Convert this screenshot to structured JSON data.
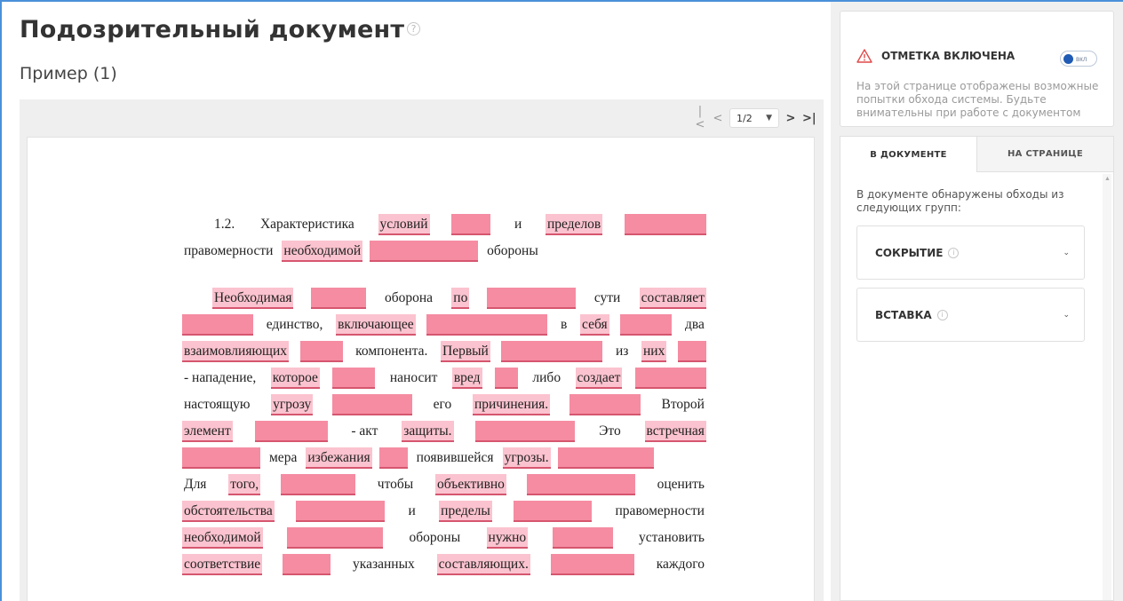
{
  "page": {
    "title": "Подозрительный документ",
    "help_icon": "question-circle-icon",
    "subtitle": "Пример (1)"
  },
  "pager": {
    "first_icon": "|<",
    "prev_icon": "<",
    "current": "1/2",
    "next_icon": ">",
    "last_icon": ">|"
  },
  "document": {
    "lines": [
      {
        "style": "title-indent",
        "tokens": [
          {
            "t": "1.2."
          },
          {
            "t": "Характеристика"
          },
          {
            "t": "условий",
            "hl": true
          },
          {
            "blk": 44
          },
          {
            "t": "и"
          },
          {
            "t": "пределов",
            "hl": true
          },
          {
            "blk": 92
          }
        ]
      },
      {
        "style": "left",
        "gap_after": true,
        "tokens": [
          {
            "t": "правомерности"
          },
          {
            "t": "необходимой",
            "hl": true
          },
          {
            "blk": 122
          },
          {
            "t": "обороны"
          }
        ]
      },
      {
        "style": "indent",
        "tokens": [
          {
            "t": "Необходимая",
            "hl": true
          },
          {
            "blk": 62
          },
          {
            "t": "оборона"
          },
          {
            "t": "по",
            "hl": true
          },
          {
            "blk": 100
          },
          {
            "t": "сути"
          },
          {
            "t": "составляет",
            "hl": true
          }
        ]
      },
      {
        "style": "justify",
        "tokens": [
          {
            "blk": 80
          },
          {
            "t": "единство,"
          },
          {
            "t": "включающее",
            "hl": true
          },
          {
            "blk": 136
          },
          {
            "t": "в"
          },
          {
            "t": "себя",
            "hl": true
          },
          {
            "blk": 58
          },
          {
            "t": "два"
          }
        ]
      },
      {
        "style": "justify",
        "tokens": [
          {
            "t": "взаимовлияющих",
            "hl": true
          },
          {
            "blk": 48
          },
          {
            "t": "компонента."
          },
          {
            "t": "Первый",
            "hl": true
          },
          {
            "blk": 114
          },
          {
            "t": "из"
          },
          {
            "t": "них",
            "hl": true
          },
          {
            "blk": 32
          }
        ]
      },
      {
        "style": "justify",
        "tokens": [
          {
            "t": "- нападение,"
          },
          {
            "t": "которое",
            "hl": true
          },
          {
            "blk": 48
          },
          {
            "t": "наносит"
          },
          {
            "t": "вред",
            "hl": true
          },
          {
            "blk": 26
          },
          {
            "t": "либо"
          },
          {
            "t": "создает",
            "hl": true
          },
          {
            "blk": 80
          }
        ]
      },
      {
        "style": "justify",
        "tokens": [
          {
            "t": "настоящую"
          },
          {
            "t": "угрозу",
            "hl": true
          },
          {
            "blk": 90
          },
          {
            "t": "его"
          },
          {
            "t": "причинения.",
            "hl": true
          },
          {
            "blk": 80
          },
          {
            "t": "Второй"
          }
        ]
      },
      {
        "style": "justify",
        "tokens": [
          {
            "t": "элемент",
            "hl": true
          },
          {
            "blk": 82
          },
          {
            "t": "- акт"
          },
          {
            "t": "защиты.",
            "hl": true
          },
          {
            "blk": 112
          },
          {
            "t": "Это"
          },
          {
            "t": "встречная",
            "hl": true
          }
        ]
      },
      {
        "style": "left",
        "tokens": [
          {
            "blk": 88
          },
          {
            "t": "мера"
          },
          {
            "t": "избежания",
            "hl": true
          },
          {
            "blk": 32
          },
          {
            "t": "появившейся"
          },
          {
            "t": "угрозы.",
            "hl": true
          },
          {
            "blk": 108
          }
        ]
      },
      {
        "style": "justify",
        "tokens": [
          {
            "t": "      Для"
          },
          {
            "t": "того,",
            "hl": true
          },
          {
            "blk": 84
          },
          {
            "t": "чтобы"
          },
          {
            "t": "объективно",
            "hl": true
          },
          {
            "blk": 122
          },
          {
            "t": "оценить"
          }
        ]
      },
      {
        "style": "justify",
        "tokens": [
          {
            "t": "обстоятельства",
            "hl": true
          },
          {
            "blk": 100
          },
          {
            "t": "и"
          },
          {
            "t": "пределы",
            "hl": true
          },
          {
            "blk": 88
          },
          {
            "t": "правомерности"
          }
        ]
      },
      {
        "style": "justify",
        "tokens": [
          {
            "t": "необходимой",
            "hl": true
          },
          {
            "blk": 108
          },
          {
            "t": "обороны"
          },
          {
            "t": "нужно",
            "hl": true
          },
          {
            "blk": 68
          },
          {
            "t": "установить"
          }
        ]
      },
      {
        "style": "justify",
        "tokens": [
          {
            "t": "соответствие",
            "hl": true
          },
          {
            "blk": 54
          },
          {
            "t": "указанных"
          },
          {
            "t": "составляющих.",
            "hl": true
          },
          {
            "blk": 94
          },
          {
            "t": "каждого"
          }
        ]
      }
    ]
  },
  "side": {
    "alert": {
      "icon": "warning-triangle-icon",
      "title": "ОТМЕТКА ВКЛЮЧЕНА",
      "toggle_label": "вкл",
      "toggle_on": true,
      "text": "На этой странице отображены возможные попытки обхода системы. Будьте внимательны при работе с документом"
    },
    "tabs": [
      {
        "label": "В ДОКУМЕНТЕ",
        "active": true
      },
      {
        "label": "НА СТРАНИЦЕ",
        "active": false
      }
    ],
    "intro": "В документе обнаружены обходы из следующих групп:",
    "groups": [
      {
        "name": "СОКРЫТИЕ"
      },
      {
        "name": "ВСТАВКА"
      }
    ]
  },
  "colors": {
    "highlight_word": "#fbc3cf",
    "highlight_block": "#f58ca2",
    "underline": "#d6566f",
    "toggle": "#1f5bb4",
    "warning": "#e04a4a",
    "frame": "#4a90d9"
  }
}
